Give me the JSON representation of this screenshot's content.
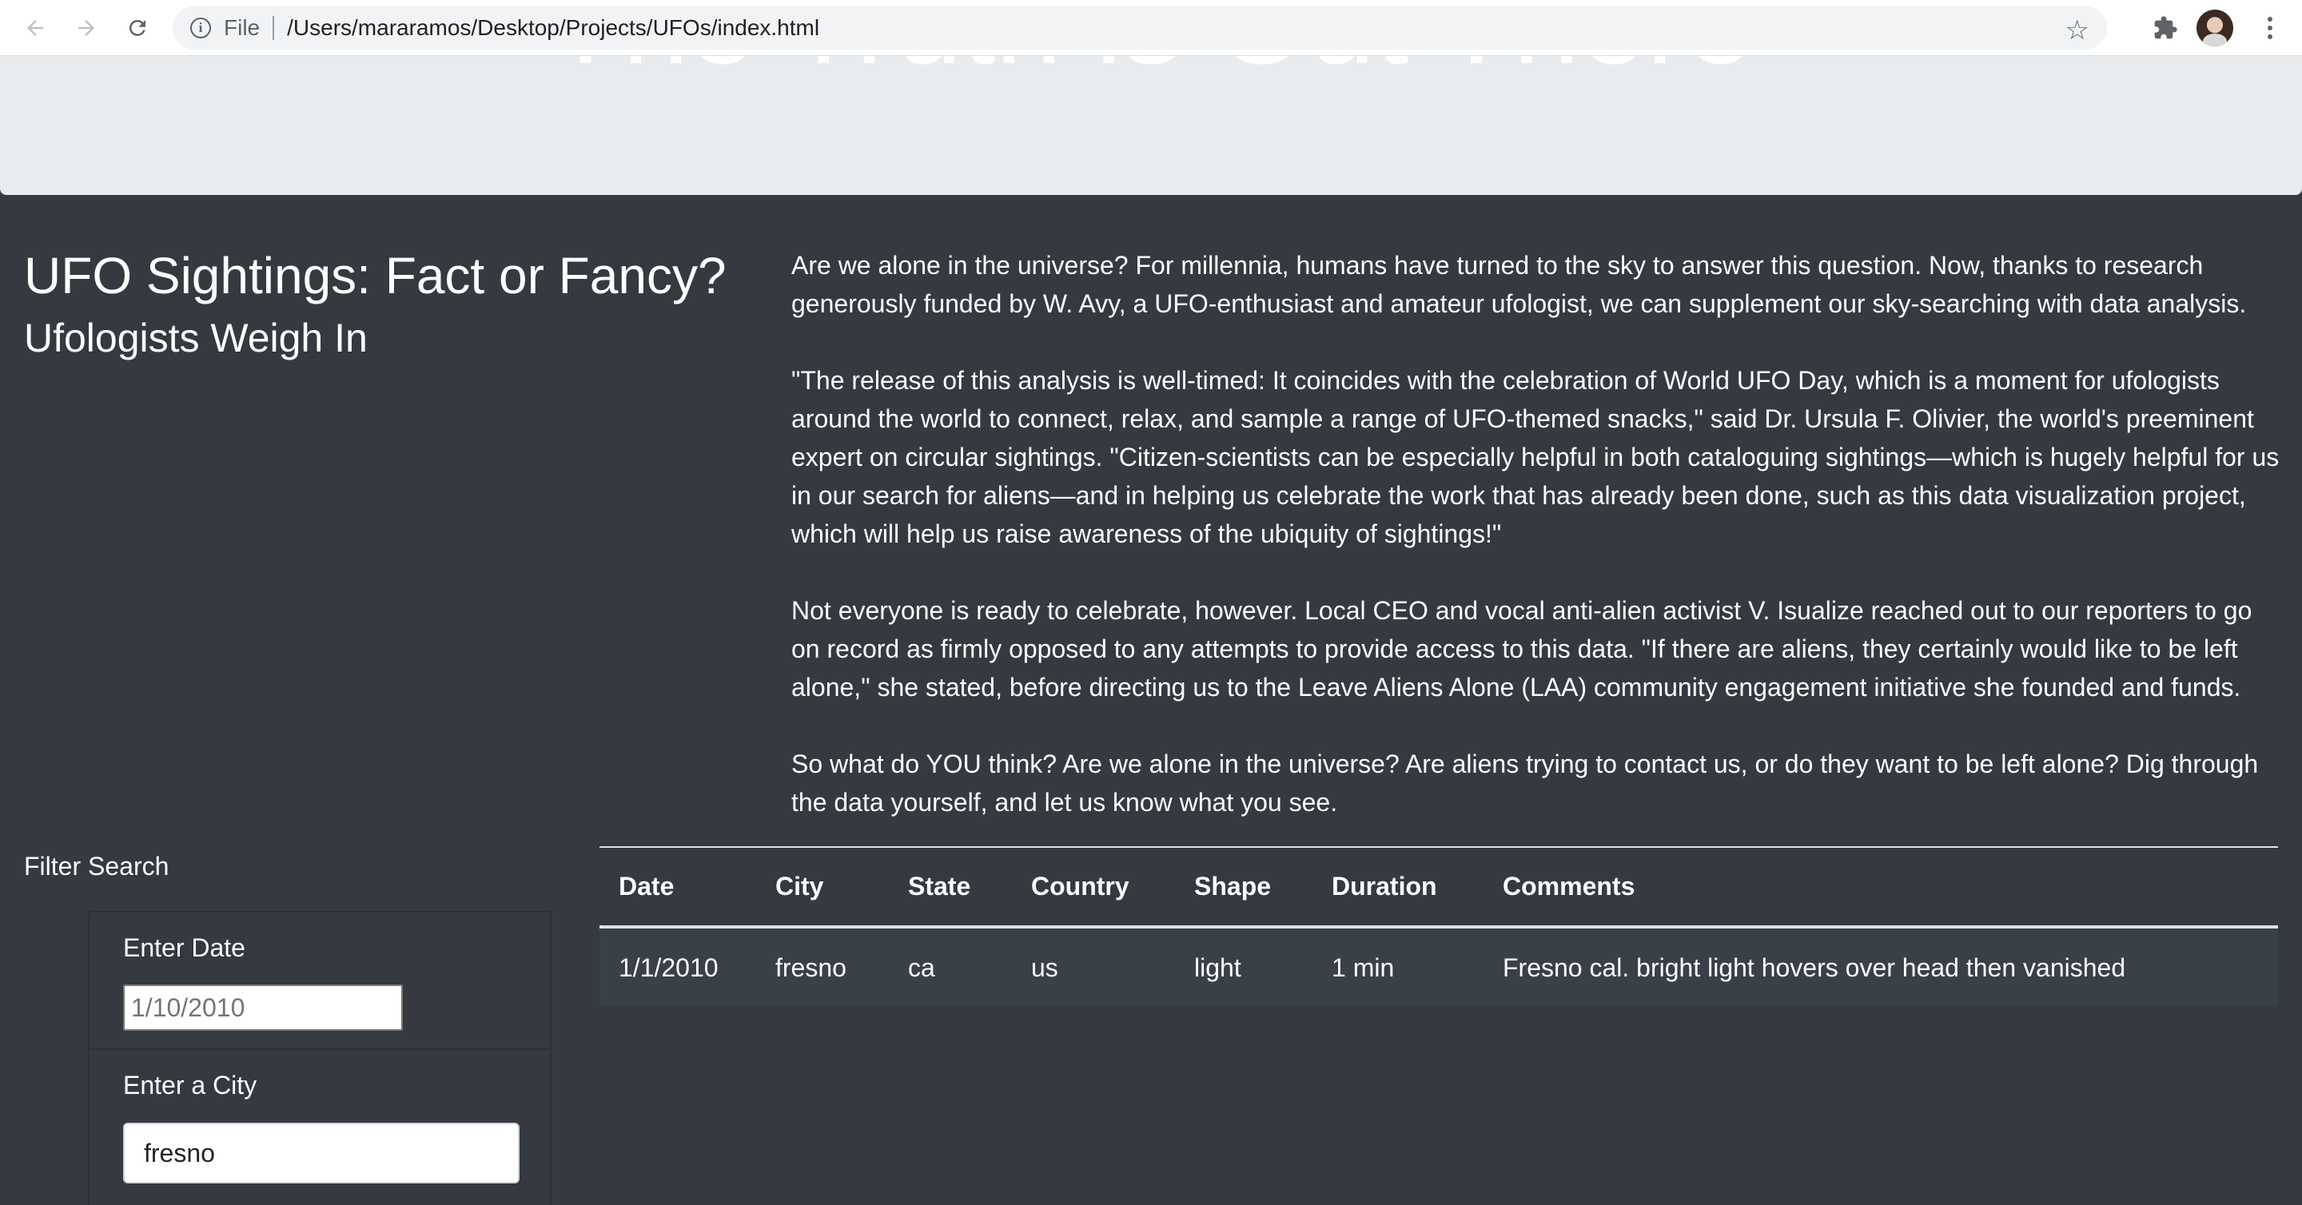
{
  "browser": {
    "file_label": "File",
    "url": "/Users/mararamos/Desktop/Projects/UFOs/index.html"
  },
  "jumbotron": {
    "title": "The Truth is Out There"
  },
  "article": {
    "headline": "UFO Sightings: Fact or Fancy?",
    "subhead": "Ufologists Weigh In",
    "paragraphs": [
      "Are we alone in the universe? For millennia, humans have turned to the sky to answer this question. Now, thanks to research generously funded by W. Avy, a UFO-enthusiast and amateur ufologist, we can supplement our sky-searching with data analysis.",
      "\"The release of this analysis is well-timed: It coincides with the celebration of World UFO Day, which is a moment for ufologists around the world to connect, relax, and sample a range of UFO-themed snacks,\" said Dr. Ursula F. Olivier, the world's preeminent expert on circular sightings. \"Citizen-scientists can be especially helpful in both cataloguing sightings—which is hugely helpful for us in our search for aliens—and in helping us celebrate the work that has already been done, such as this data visualization project, which will help us raise awareness of the ubiquity of sightings!\"",
      "Not everyone is ready to celebrate, however. Local CEO and vocal anti-alien activist V. Isualize reached out to our reporters to go on record as firmly opposed to any attempts to provide access to this data. \"If there are aliens, they certainly would like to be left alone,\" she stated, before directing us to the Leave Aliens Alone (LAA) community engagement initiative she founded and funds.",
      "So what do YOU think? Are we alone in the universe? Are aliens trying to contact us, or do they want to be left alone? Dig through the data yourself, and let us know what you see."
    ]
  },
  "filters": {
    "title": "Filter Search",
    "date_label": "Enter Date",
    "date_placeholder": "1/10/2010",
    "city_label": "Enter a City",
    "city_value": "fresno"
  },
  "table": {
    "headers": [
      "Date",
      "City",
      "State",
      "Country",
      "Shape",
      "Duration",
      "Comments"
    ],
    "rows": [
      [
        "1/1/2010",
        "fresno",
        "ca",
        "us",
        "light",
        "1 min",
        "Fresno cal. bright light hovers over head then vanished"
      ]
    ]
  }
}
